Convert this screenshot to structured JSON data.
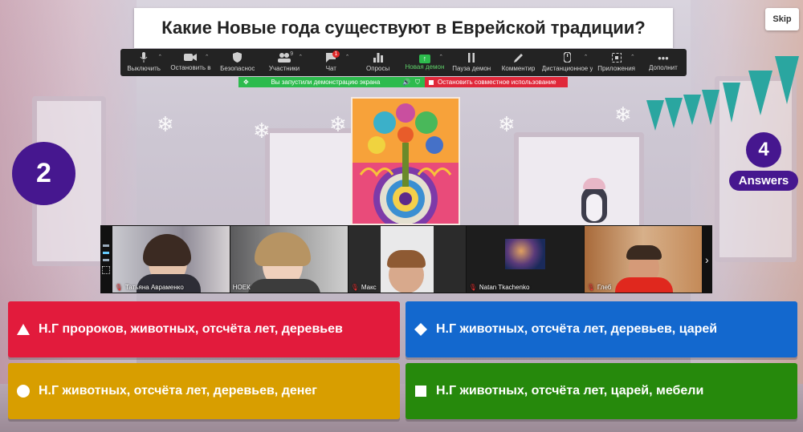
{
  "question": {
    "text": "Какие Новые года существуют в Еврейской  традиции?"
  },
  "skip_label": "Skip",
  "toolbar": {
    "items": [
      {
        "label": "Выключить",
        "icon": "microphone-icon"
      },
      {
        "label": "Остановить в",
        "icon": "video-camera-icon"
      },
      {
        "label": "Безопаснос",
        "icon": "shield-icon"
      },
      {
        "label": "Участники",
        "icon": "participants-icon",
        "count": "9"
      },
      {
        "label": "Чат",
        "icon": "chat-icon",
        "badge": "1"
      },
      {
        "label": "Опросы",
        "icon": "polls-icon"
      },
      {
        "label": "Новая демон",
        "icon": "share-screen-icon"
      },
      {
        "label": "Пауза демон",
        "icon": "pause-icon"
      },
      {
        "label": "Комментир",
        "icon": "annotate-pen-icon"
      },
      {
        "label": "Дистанционное у",
        "icon": "remote-control-icon"
      },
      {
        "label": "Приложения",
        "icon": "apps-icon"
      },
      {
        "label": "Дополнит",
        "icon": "more-icon"
      }
    ]
  },
  "share_bar": {
    "status": "Вы запустили демонстрацию экрана",
    "stop": "Остановить совместное использование"
  },
  "counter": "2",
  "answers": {
    "count": "4",
    "label": "Answers"
  },
  "participants": [
    {
      "name": "Татьяна Авраменко"
    },
    {
      "name": "НОЕК"
    },
    {
      "name": "Макс"
    },
    {
      "name": "Natan Tkachenko"
    },
    {
      "name": "Глеб"
    }
  ],
  "choices": [
    {
      "text": "Н.Г пророков, животных, отсчёта лет, деревьев",
      "shape": "triangle-icon",
      "color": "#e21b3c"
    },
    {
      "text": "Н.Г животных, отсчёта лет, деревьев, царей",
      "shape": "diamond-icon",
      "color": "#1368ce"
    },
    {
      "text": "Н.Г животных, отсчёта лет, деревьев, денег",
      "shape": "circle-icon",
      "color": "#d89e00"
    },
    {
      "text": "Н.Г животных, отсчёта лет, царей, мебели",
      "shape": "square-icon",
      "color": "#26890c"
    }
  ],
  "colors": {
    "kahoot_purple": "#46178f",
    "share_green": "#2dbb4d",
    "stop_red": "#e0283a"
  }
}
